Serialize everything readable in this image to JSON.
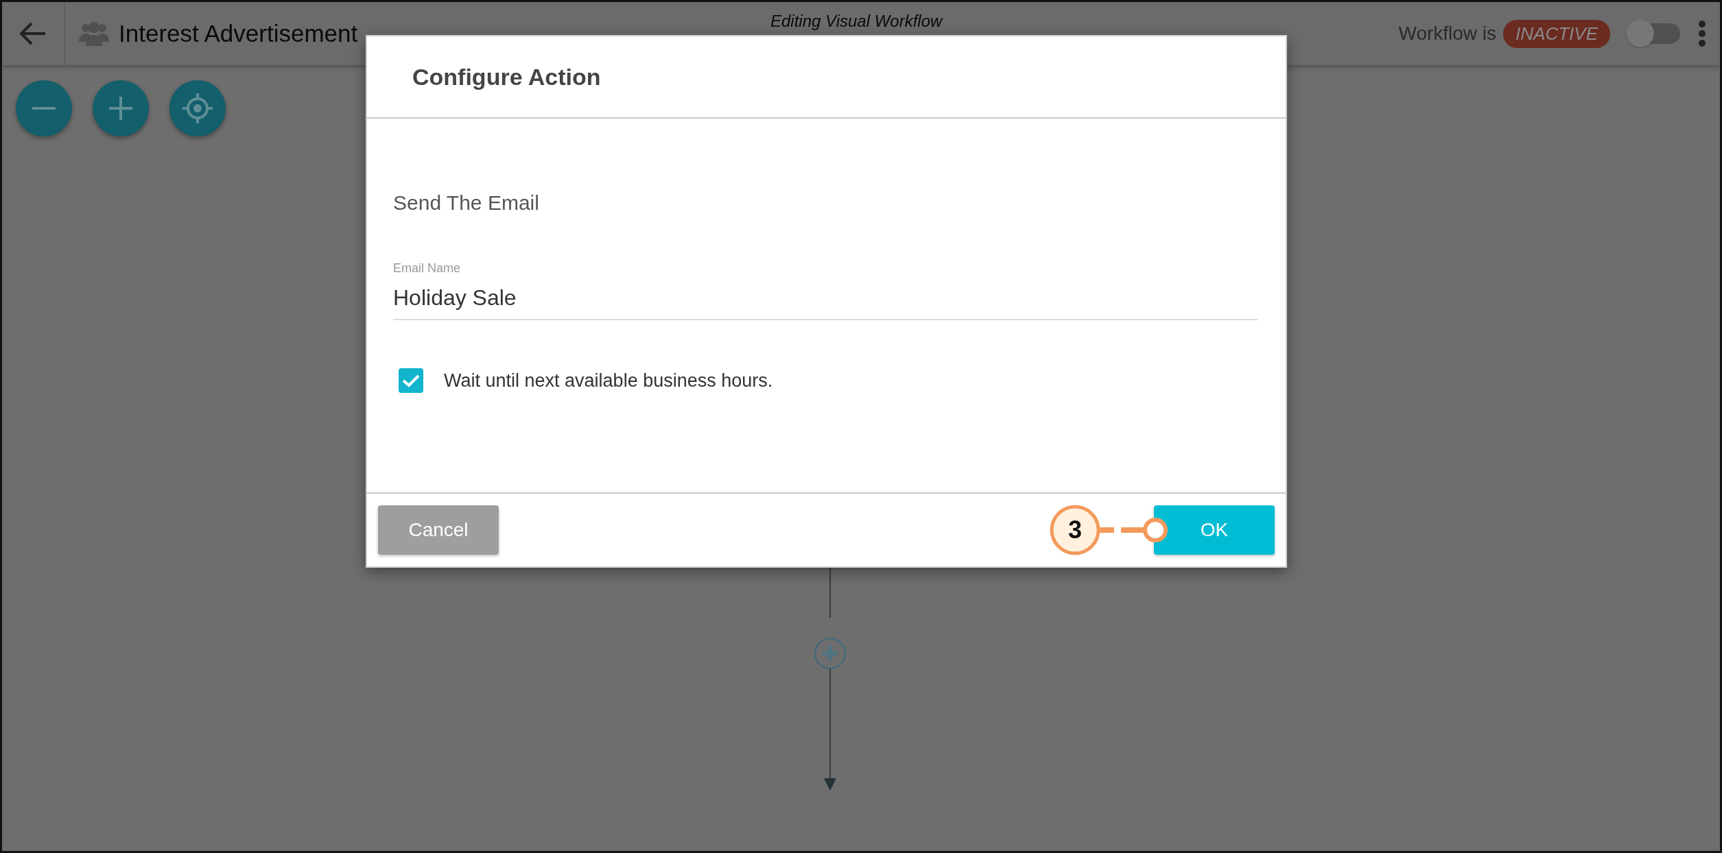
{
  "topbar": {
    "workflow_name": "Interest Advertisement",
    "subtitle": "Editing Visual Workflow",
    "status_label": "Workflow is",
    "status_badge": "INACTIVE",
    "active": false
  },
  "dialog": {
    "title": "Configure Action",
    "section": "Send The Email",
    "field": {
      "label": "Email Name",
      "value": "Holiday Sale"
    },
    "option": {
      "label": "Wait until next available business hours.",
      "checked": true
    },
    "buttons": [
      {
        "label": "Cancel",
        "kind": "secondary"
      },
      {
        "label": "OK",
        "kind": "primary"
      }
    ]
  },
  "callout": {
    "number": "3"
  }
}
